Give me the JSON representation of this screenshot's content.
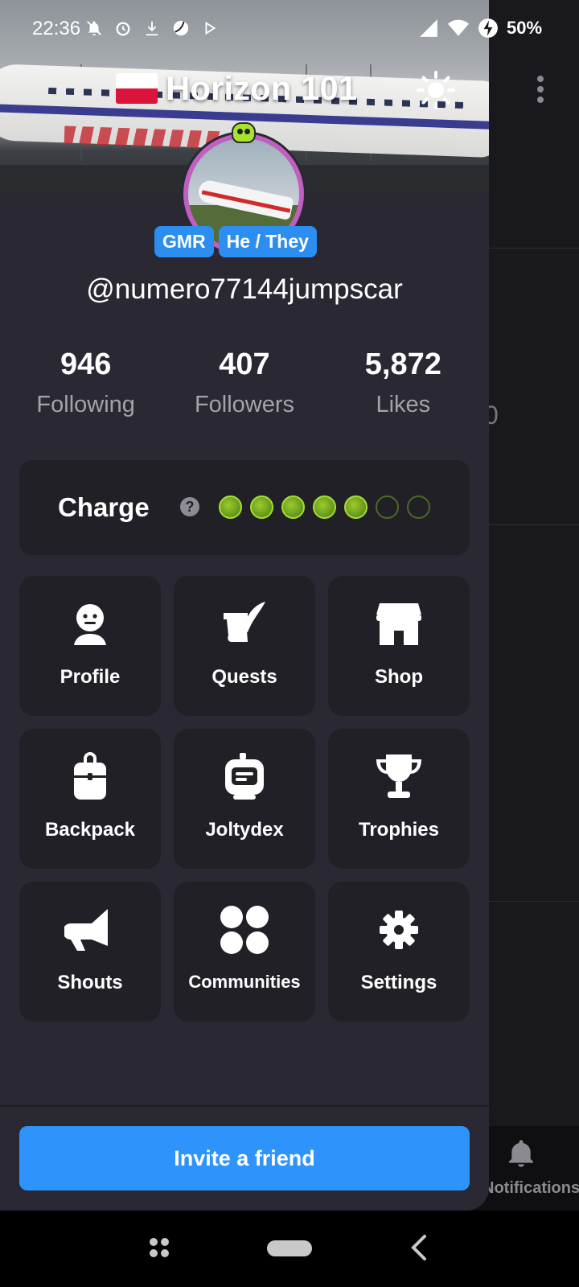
{
  "status_bar": {
    "time": "22:36",
    "battery": "50%"
  },
  "header": {
    "title": "Horizon 101"
  },
  "profile": {
    "tags": [
      "GMR",
      "He / They"
    ],
    "username": "@numero77144jumpscar"
  },
  "stats": [
    {
      "value": "946",
      "label": "Following"
    },
    {
      "value": "407",
      "label": "Followers"
    },
    {
      "value": "5,872",
      "label": "Likes"
    }
  ],
  "charge": {
    "label": "Charge",
    "help": "?",
    "level": 5,
    "max": 7
  },
  "menu": [
    {
      "label": "Profile",
      "icon": "profile-face-icon"
    },
    {
      "label": "Quests",
      "icon": "quill-scroll-icon"
    },
    {
      "label": "Shop",
      "icon": "storefront-icon"
    },
    {
      "label": "Backpack",
      "icon": "backpack-icon"
    },
    {
      "label": "Joltydex",
      "icon": "robot-device-icon"
    },
    {
      "label": "Trophies",
      "icon": "trophy-icon"
    },
    {
      "label": "Shouts",
      "icon": "megaphone-icon"
    },
    {
      "label": "Communities",
      "icon": "four-dots-icon"
    },
    {
      "label": "Settings",
      "icon": "gear-icon"
    }
  ],
  "invite_button": "Invite a friend",
  "background": {
    "notifications_label": "Notifications",
    "stray_char": "0"
  },
  "colors": {
    "accent": "#2e93fa",
    "tag": "#2b8ef0",
    "charge": "#9acc2c",
    "drawer": "#2a2832",
    "tile": "#212027"
  }
}
